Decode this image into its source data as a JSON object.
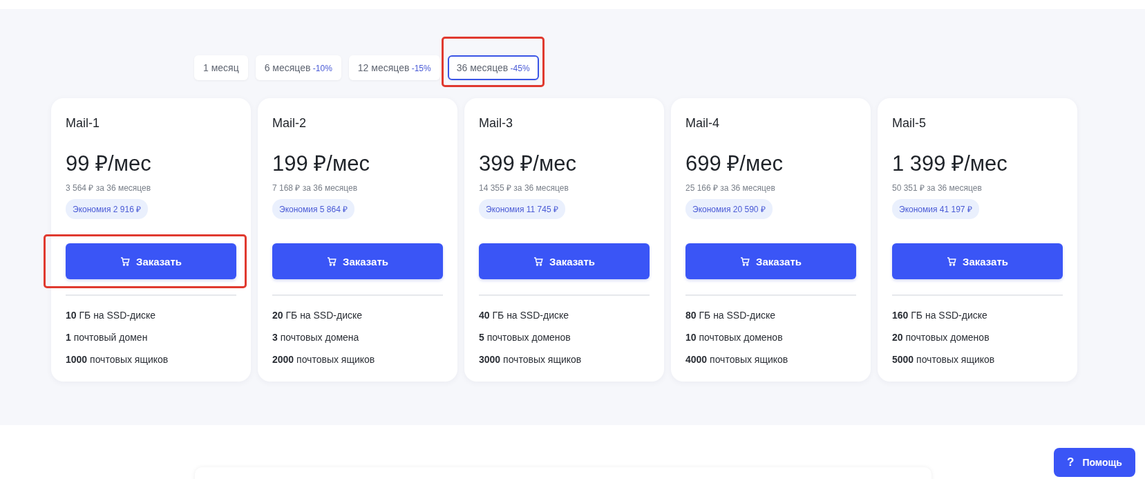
{
  "periods": [
    {
      "label": "1 месяц",
      "selected": false,
      "annotated": false
    },
    {
      "label": "6 месяцев",
      "discount": "-10%",
      "selected": false,
      "annotated": false
    },
    {
      "label": "12 месяцев",
      "discount": "-15%",
      "selected": false,
      "annotated": false
    },
    {
      "label": "36 месяцев",
      "discount": "-45%",
      "selected": true,
      "annotated": true
    }
  ],
  "plans": [
    {
      "name": "Mail-1",
      "price": "99 ₽/мес",
      "total": "3 564 ₽ за 36 месяцев",
      "savings": "Экономия 2 916 ₽",
      "button": "Заказать",
      "button_annotated": true,
      "features": [
        "**10** ГБ на SSD-диске",
        "**1** почтовый домен",
        "**1000** почтовых ящиков"
      ]
    },
    {
      "name": "Mail-2",
      "price": "199 ₽/мес",
      "total": "7 168 ₽ за 36 месяцев",
      "savings": "Экономия 5 864 ₽",
      "button": "Заказать",
      "button_annotated": false,
      "features": [
        "**20** ГБ на SSD-диске",
        "**3** почтовых домена",
        "**2000** почтовых ящиков"
      ]
    },
    {
      "name": "Mail-3",
      "price": "399 ₽/мес",
      "total": "14 355 ₽ за 36 месяцев",
      "savings": "Экономия 11 745 ₽",
      "button": "Заказать",
      "button_annotated": false,
      "features": [
        "**40** ГБ на SSD-диске",
        "**5** почтовых доменов",
        "**3000** почтовых ящиков"
      ]
    },
    {
      "name": "Mail-4",
      "price": "699 ₽/мес",
      "total": "25 166 ₽ за 36 месяцев",
      "savings": "Экономия 20 590 ₽",
      "button": "Заказать",
      "button_annotated": false,
      "features": [
        "**80** ГБ на SSD-диске",
        "**10** почтовых доменов",
        "**4000** почтовых ящиков"
      ]
    },
    {
      "name": "Mail-5",
      "price": "1 399 ₽/мес",
      "total": "50 351 ₽ за 36 месяцев",
      "savings": "Экономия 41 197 ₽",
      "button": "Заказать",
      "button_annotated": false,
      "features": [
        "**160** ГБ на SSD-диске",
        "**20** почтовых доменов",
        "**5000** почтовых ящиков"
      ]
    }
  ],
  "help_button": {
    "icon": "?",
    "label": "Помощь"
  }
}
